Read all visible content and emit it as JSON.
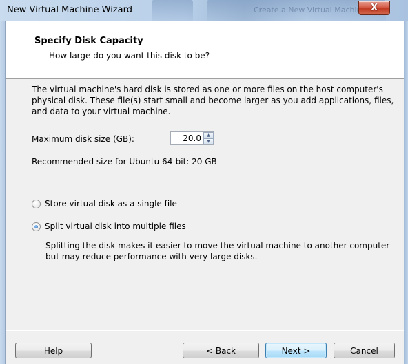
{
  "window": {
    "title": "New Virtual Machine Wizard",
    "close_glyph": "X",
    "background_window_title": "Create a New Virtual Machine"
  },
  "header": {
    "title": "Specify Disk Capacity",
    "subtitle": "How large do you want this disk to be?"
  },
  "body": {
    "description": "The virtual machine's hard disk is stored as one or more files on the host computer's physical disk. These file(s) start small and become larger as you add applications, files, and data to your virtual machine.",
    "disk_size_label": "Maximum disk size (GB):",
    "disk_size_value": "20.0",
    "recommended": "Recommended size for Ubuntu 64-bit: 20 GB",
    "options": [
      {
        "label": "Store virtual disk as a single file",
        "checked": false
      },
      {
        "label": "Split virtual disk into multiple files",
        "checked": true
      }
    ],
    "split_description": "Splitting the disk makes it easier to move the virtual machine to another computer but may reduce performance with very large disks."
  },
  "footer": {
    "help": "Help",
    "back": "< Back",
    "next": "Next >",
    "cancel": "Cancel"
  },
  "icons": {
    "spin_up": "triangle-up",
    "spin_down": "triangle-down"
  },
  "colors": {
    "close_button": "#c94a33",
    "default_button_border": "#3c7fb1"
  }
}
